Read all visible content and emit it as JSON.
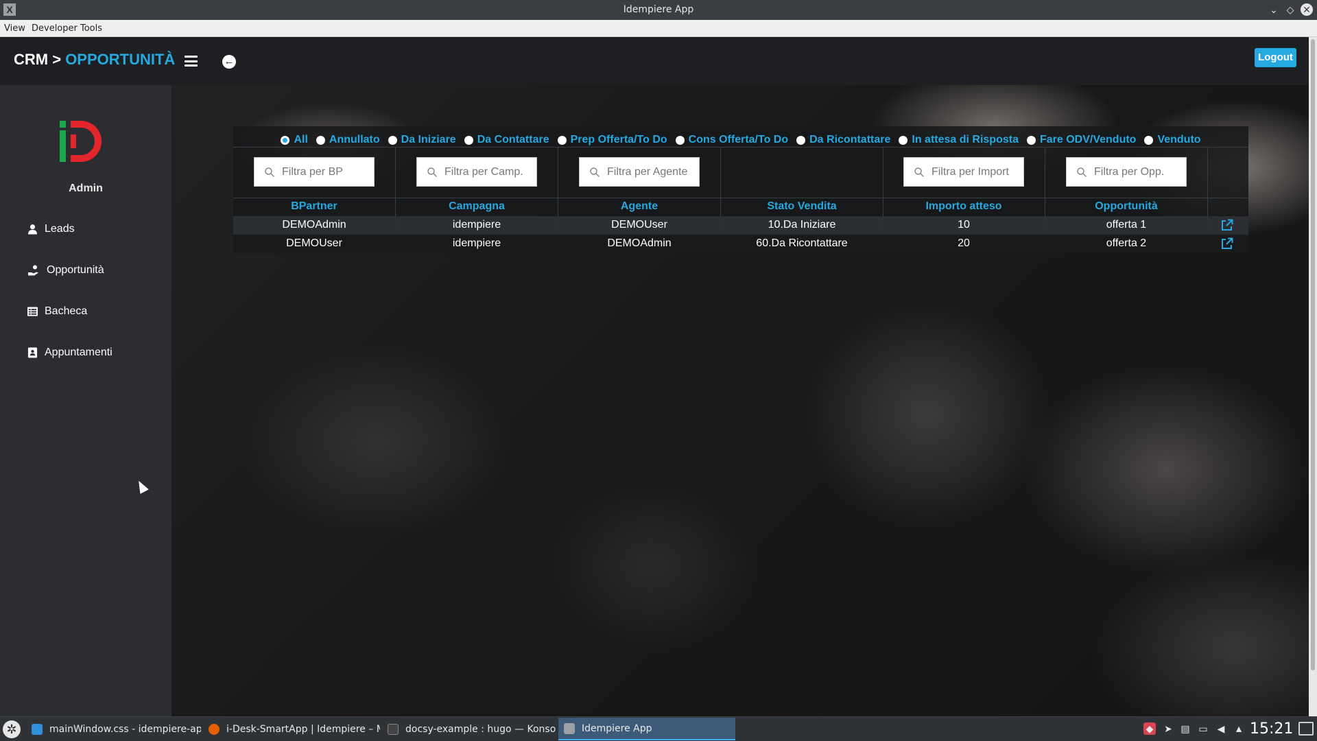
{
  "window": {
    "title": "Idempiere App"
  },
  "menubar": {
    "items": [
      "View",
      "Developer Tools"
    ]
  },
  "header": {
    "crumb_root": "CRM >",
    "crumb_current": "OPPORTUNITÀ",
    "logout_label": "Logout"
  },
  "sidebar": {
    "user": "Admin",
    "items": [
      {
        "label": "Leads",
        "icon": "user-icon"
      },
      {
        "label": "Opportunità",
        "icon": "hand-holding-icon"
      },
      {
        "label": "Bacheca",
        "icon": "list-icon"
      },
      {
        "label": "Appuntamenti",
        "icon": "address-book-icon"
      }
    ]
  },
  "filters": {
    "status_options": [
      {
        "label": "All",
        "selected": true
      },
      {
        "label": "Annullato",
        "selected": false
      },
      {
        "label": "Da Iniziare",
        "selected": false
      },
      {
        "label": "Da Contattare",
        "selected": false
      },
      {
        "label": "Prep Offerta/To Do",
        "selected": false
      },
      {
        "label": "Cons Offerta/To Do",
        "selected": false
      },
      {
        "label": "Da Ricontattare",
        "selected": false
      },
      {
        "label": "In attesa di Risposta",
        "selected": false
      },
      {
        "label": "Fare ODV/Venduto",
        "selected": false
      },
      {
        "label": "Venduto",
        "selected": false
      }
    ],
    "bp_placeholder": "Filtra per BP",
    "camp_placeholder": "Filtra per Camp.",
    "agent_placeholder": "Filtra per Agente",
    "import_placeholder": "Filtra per Import",
    "opp_placeholder": "Filtra per Opp."
  },
  "table": {
    "columns": [
      "BPartner",
      "Campagna",
      "Agente",
      "Stato Vendita",
      "Importo atteso",
      "Opportunità"
    ],
    "rows": [
      [
        "DEMOAdmin",
        "idempiere",
        "DEMOUser",
        "10.Da Iniziare",
        "10",
        "offerta 1"
      ],
      [
        "DEMOUser",
        "idempiere",
        "DEMOAdmin",
        "60.Da Ricontattare",
        "20",
        "offerta 2"
      ]
    ]
  },
  "taskbar": {
    "tasks": [
      {
        "label": "mainWindow.css - idempiere-app -...",
        "icon": "vscode-icon",
        "active": false
      },
      {
        "label": "i-Desk-SmartApp | Idempiere – M...",
        "icon": "firefox-icon",
        "active": false
      },
      {
        "label": "docsy-example : hugo — Konsole",
        "icon": "terminal-icon",
        "active": false
      },
      {
        "label": "Idempiere App",
        "icon": "app-icon",
        "active": true
      }
    ],
    "clock": "15:21"
  },
  "colors": {
    "accent": "#26a9e0",
    "header_bg": "#1d1f22",
    "sidebar_bg": "#2b2d31",
    "logo_green": "#1aa84a",
    "logo_red": "#e3262b"
  }
}
